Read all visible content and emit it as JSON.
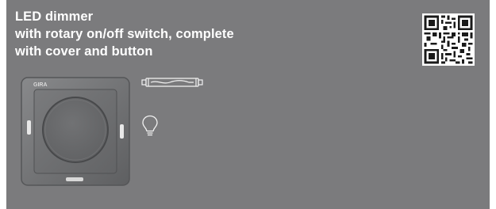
{
  "product": {
    "title_lines": [
      "LED dimmer",
      "with rotary on/off switch, complete",
      "with cover and button"
    ],
    "brand_logo_text": "GIRA"
  },
  "icons": {
    "qr": "qr-code-icon",
    "switch": "dimmer-switch-image",
    "tube": "fluorescent-tube-icon",
    "bulb": "light-bulb-icon"
  },
  "colors": {
    "panel_background": "#7b7b7d",
    "title_text": "#ffffff",
    "switch_frame": "#6e6f71",
    "switch_knob": "#67686a"
  }
}
